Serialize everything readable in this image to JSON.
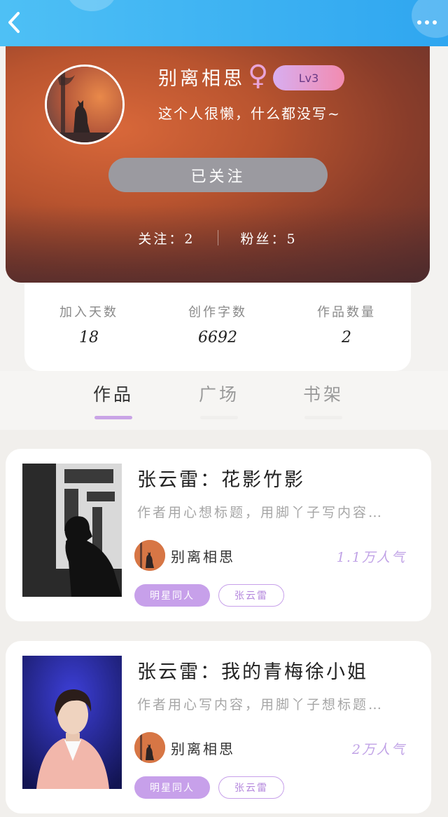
{
  "topbar": {
    "back_icon": "chevron-left-icon",
    "more_icon": "more-dots-icon"
  },
  "profile": {
    "username": "别离相思",
    "gender_symbol": "♀",
    "level": "Lv3",
    "bio": "这个人很懒，什么都没写~",
    "follow_button": "已关注",
    "following": "关注：2",
    "followers": "粉丝：5"
  },
  "counts": [
    {
      "label": "加入天数",
      "value": "18"
    },
    {
      "label": "创作字数",
      "value": "6692"
    },
    {
      "label": "作品数量",
      "value": "2"
    }
  ],
  "tabs": [
    {
      "label": "作品",
      "active": true
    },
    {
      "label": "广场",
      "active": false
    },
    {
      "label": "书架",
      "active": false
    }
  ],
  "works": [
    {
      "title": "张云雷：花影竹影",
      "desc": "作者用心想标题，用脚丫子写内容…",
      "author": "别离相思",
      "popularity": "1.1万人气",
      "tags": [
        "明星同人",
        "张云雷"
      ]
    },
    {
      "title": "张云雷：我的青梅徐小姐",
      "desc": "作者用心写内容，用脚丫子想标题…",
      "author": "别离相思",
      "popularity": "2万人气",
      "tags": [
        "明星同人",
        "张云雷"
      ]
    }
  ],
  "colors": {
    "topbar": "#2fa6f0",
    "accent": "#c7a0ea",
    "profile_bg": "#b9542f"
  }
}
